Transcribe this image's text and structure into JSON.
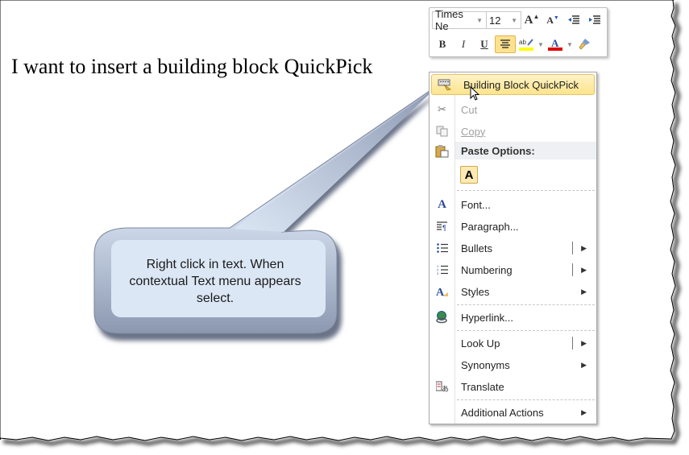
{
  "document": {
    "body_text": "I want to insert a building block QuickPick"
  },
  "mini_toolbar": {
    "font_name": "Times Ne",
    "font_size": "12",
    "grow_font_icon": "grow-font-icon",
    "shrink_font_icon": "shrink-font-icon",
    "decrease_indent_icon": "decrease-indent-icon",
    "increase_indent_icon": "increase-indent-icon",
    "bold": "B",
    "italic": "I",
    "underline": "U",
    "highlight_color": "#ffff00",
    "font_color": "#e00000",
    "center_active": true
  },
  "context_menu": {
    "items": [
      {
        "label": "Building Block QuickPick",
        "icon": "building-block-icon",
        "state": "highlighted"
      },
      {
        "label": "Cut",
        "icon": "scissors-icon",
        "state": "disabled"
      },
      {
        "label": "Copy",
        "icon": "copy-icon",
        "state": "disabled"
      },
      {
        "label": "Paste Options:",
        "icon": "paste-icon",
        "state": "header"
      },
      {
        "label": "A",
        "icon": "keep-text-only-icon"
      },
      {
        "label": "Font...",
        "icon": "font-icon"
      },
      {
        "label": "Paragraph...",
        "icon": "paragraph-icon"
      },
      {
        "label": "Bullets",
        "icon": "bullets-icon",
        "submenu": true
      },
      {
        "label": "Numbering",
        "icon": "numbering-icon",
        "submenu": true
      },
      {
        "label": "Styles",
        "icon": "styles-icon",
        "submenu": true
      },
      {
        "label": "Hyperlink...",
        "icon": "hyperlink-icon"
      },
      {
        "label": "Look Up",
        "submenu": true
      },
      {
        "label": "Synonyms",
        "submenu": true
      },
      {
        "label": "Translate",
        "icon": "translate-icon"
      },
      {
        "label": "Additional Actions",
        "submenu": true
      }
    ]
  },
  "callout": {
    "text_line1": "Right click in text.  When",
    "text_line2": "contextual Text menu appears",
    "text_line3": "select."
  }
}
